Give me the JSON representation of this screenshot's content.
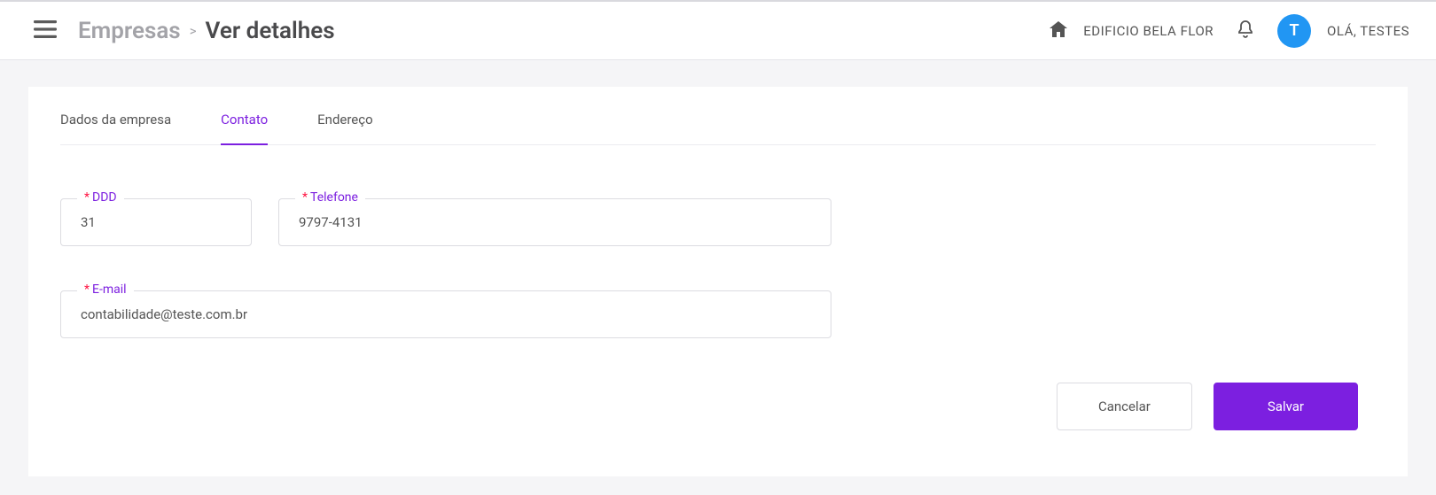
{
  "header": {
    "breadcrumb_root": "Empresas",
    "breadcrumb_sep": ">",
    "breadcrumb_current": "Ver detalhes",
    "building": "EDIFICIO BELA FLOR",
    "avatar_initial": "T",
    "greeting": "OLÁ, TESTES"
  },
  "tabs": {
    "company": "Dados da empresa",
    "contact": "Contato",
    "address": "Endereço"
  },
  "form": {
    "ddd_label": "DDD",
    "ddd_value": "31",
    "phone_label": "Telefone",
    "phone_value": "9797-4131",
    "email_label": "E-mail",
    "email_value": "contabilidade@teste.com.br"
  },
  "actions": {
    "cancel": "Cancelar",
    "save": "Salvar"
  }
}
